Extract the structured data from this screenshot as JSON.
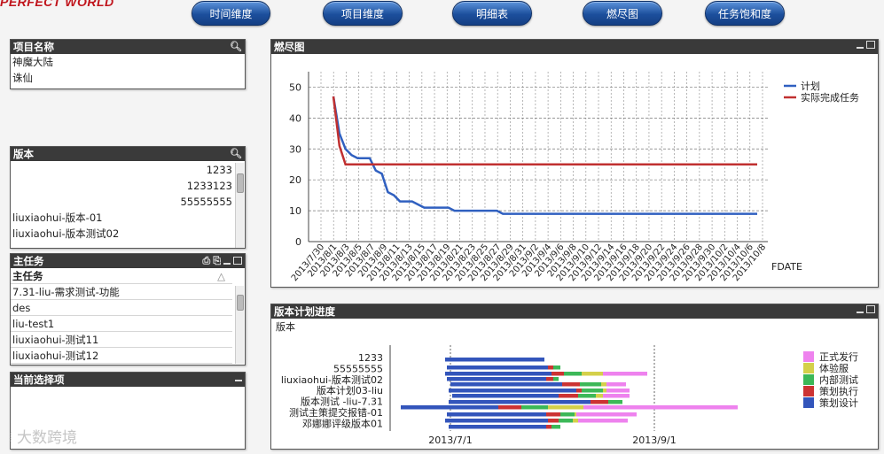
{
  "app": {
    "logo": "PERFECT WORLD",
    "watermark": "大数跨境"
  },
  "nav": [
    {
      "label": "时间维度"
    },
    {
      "label": "项目维度"
    },
    {
      "label": "明细表"
    },
    {
      "label": "燃尽图"
    },
    {
      "label": "任务饱和度"
    }
  ],
  "project_list": {
    "title": "项目名称",
    "items": [
      "神魔大陆",
      "诛仙"
    ]
  },
  "version_list": {
    "title": "版本",
    "items": [
      "1233",
      "1233123",
      "55555555",
      "liuxiaohui-版本-01",
      "liuxiaohui-版本测试02"
    ]
  },
  "task_table": {
    "title": "主任务",
    "header": "主任务",
    "sort_icon": "△",
    "rows": [
      "7.31-liu-需求测试-功能",
      "des",
      "liu-test1",
      "liuxiaohui-测试11",
      "liuxiaohui-测试12"
    ]
  },
  "current_selection": {
    "title": "当前选择项"
  },
  "burndown": {
    "title": "燃尽图"
  },
  "version_progress": {
    "title": "版本计划进度",
    "dimension_label": "版本"
  },
  "colors": {
    "plan": "#3060c0",
    "actual": "#c03030",
    "nav": "#1c4f9c",
    "header": "#3a3a3a"
  },
  "chart_data": [
    {
      "type": "line",
      "title": "",
      "xlabel": "FDATE",
      "ylabel": "",
      "ylim": [
        0,
        55
      ],
      "yticks": [
        0,
        10,
        20,
        30,
        40,
        50
      ],
      "grid": true,
      "legend_position": "top-right",
      "x": [
        "2013/7/30",
        "2013/8/1",
        "2013/8/3",
        "2013/8/5",
        "2013/8/7",
        "2013/8/9",
        "2013/8/11",
        "2013/8/13",
        "2013/8/15",
        "2013/8/17",
        "2013/8/19",
        "2013/8/21",
        "2013/8/23",
        "2013/8/25",
        "2013/8/27",
        "2013/8/29",
        "2013/8/31",
        "2013/9/2",
        "2013/9/4",
        "2013/9/6",
        "2013/9/8",
        "2013/9/10",
        "2013/9/12",
        "2013/9/14",
        "2013/9/16",
        "2013/9/18",
        "2013/9/20",
        "2013/9/22",
        "2013/9/24",
        "2013/9/26",
        "2013/9/28",
        "2013/9/30",
        "2013/10/2",
        "2013/10/4",
        "2013/10/6",
        "2013/10/8"
      ],
      "series": [
        {
          "name": "计划",
          "color": "#3060c0",
          "values": [
            47,
            35,
            30,
            28,
            27,
            27,
            27,
            23,
            22,
            16,
            15,
            13,
            13,
            13,
            12,
            11,
            11,
            11,
            11,
            11,
            10,
            10,
            10,
            10,
            10,
            10,
            10,
            10,
            9,
            9,
            9,
            9,
            9,
            9,
            9,
            9,
            9,
            9,
            9,
            9,
            9,
            9,
            9,
            9,
            9,
            9,
            9,
            9,
            9,
            9,
            9,
            9,
            9,
            9,
            9,
            9,
            9,
            9,
            9,
            9,
            9,
            9,
            9,
            9,
            9,
            9,
            9,
            9,
            9,
            9,
            9
          ]
        },
        {
          "name": "实际完成任务",
          "color": "#c03030",
          "values": [
            47,
            31,
            25,
            25,
            25,
            25,
            25,
            25,
            25,
            25,
            25,
            25,
            25,
            25,
            25,
            25,
            25,
            25,
            25,
            25,
            25,
            25,
            25,
            25,
            25,
            25,
            25,
            25,
            25,
            25,
            25,
            25,
            25,
            25,
            25,
            25,
            25,
            25,
            25,
            25,
            25,
            25,
            25,
            25,
            25,
            25,
            25,
            25,
            25,
            25,
            25,
            25,
            25,
            25,
            25,
            25,
            25,
            25,
            25,
            25,
            25,
            25,
            25,
            25,
            25,
            25,
            25,
            25,
            25,
            25,
            25
          ]
        }
      ]
    },
    {
      "type": "bar",
      "orientation": "horizontal-gantt",
      "x_tick_labels": [
        "2013/7/1",
        "2013/9/1"
      ],
      "categories": [
        "1233",
        "55555555",
        "liuxiaohui-版本测试02",
        "版本计划03-liu",
        "版本测试 -liu-7.31",
        "测试主策提交报错-01",
        "邓娜娜评级版本01"
      ],
      "legend_position": "right",
      "legend": [
        {
          "name": "正式发行",
          "color": "#ee82ee"
        },
        {
          "name": "体验服",
          "color": "#d4d04a"
        },
        {
          "name": "内部测试",
          "color": "#3cb858"
        },
        {
          "name": "策划执行",
          "color": "#cc3333"
        },
        {
          "name": "策划设计",
          "color": "#3355bb"
        }
      ]
    }
  ]
}
